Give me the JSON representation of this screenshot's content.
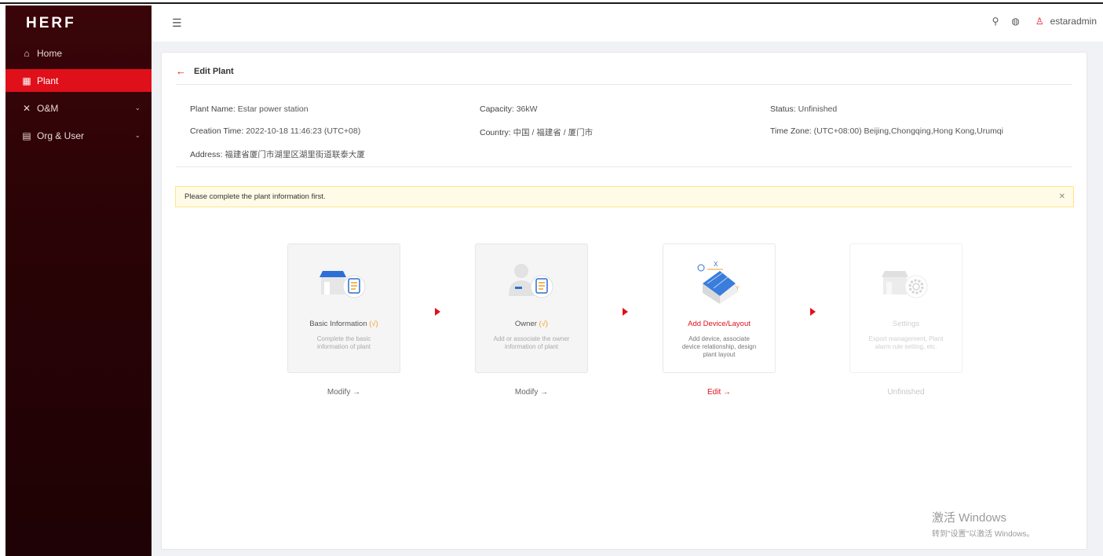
{
  "brand": {
    "logo_text": "HERF"
  },
  "sidebar": {
    "items": [
      {
        "label": "Home",
        "icon": "home-icon",
        "active": false
      },
      {
        "label": "Plant",
        "icon": "plant-icon",
        "active": true
      },
      {
        "label": "O&M",
        "icon": "tools-icon",
        "active": false,
        "has_children": true
      },
      {
        "label": "Org & User",
        "icon": "org-icon",
        "active": false,
        "has_children": true
      }
    ]
  },
  "header": {
    "username": "estaradmin"
  },
  "page": {
    "title": "Edit Plant",
    "info": {
      "plant_name_label": "Plant Name:",
      "plant_name": "Estar power station",
      "capacity_label": "Capacity:",
      "capacity": "36kW",
      "status_label": "Status:",
      "status": "Unfinished",
      "creation_time_label": "Creation Time:",
      "creation_time": "2022-10-18 11:46:23 (UTC+08)",
      "country_label": "Country:",
      "country": "中国 / 福建省 / 厦门市",
      "timezone_label": "Time Zone:",
      "timezone": "(UTC+08:00) Beijing,Chongqing,Hong Kong,Urumqi",
      "address_label": "Address:",
      "address": "福建省厦门市湖里区湖里街道联泰大厦"
    },
    "alert": "Please complete the plant information first.",
    "steps": [
      {
        "title": "Basic Information",
        "check": "(√)",
        "desc": "Complete the basic information of plant",
        "action": "Modify →"
      },
      {
        "title": "Owner",
        "check": "(√)",
        "desc": "Add or associate the owner information of plant",
        "action": "Modify →"
      },
      {
        "title": "Add Device/Layout",
        "check": "",
        "desc": "Add device, associate device relationship, design plant layout",
        "action": "Edit →"
      },
      {
        "title": "Settings",
        "check": "",
        "desc": "Export management, Plant alarm rule setting, etc.",
        "action": "Unfinished"
      }
    ]
  },
  "watermark": {
    "line1": "激活 Windows",
    "line2": "转到\"设置\"以激活 Windows。"
  },
  "colors": {
    "accent": "#e0101b",
    "sidebar_bg": "#2a0306",
    "check": "#f0a020"
  }
}
